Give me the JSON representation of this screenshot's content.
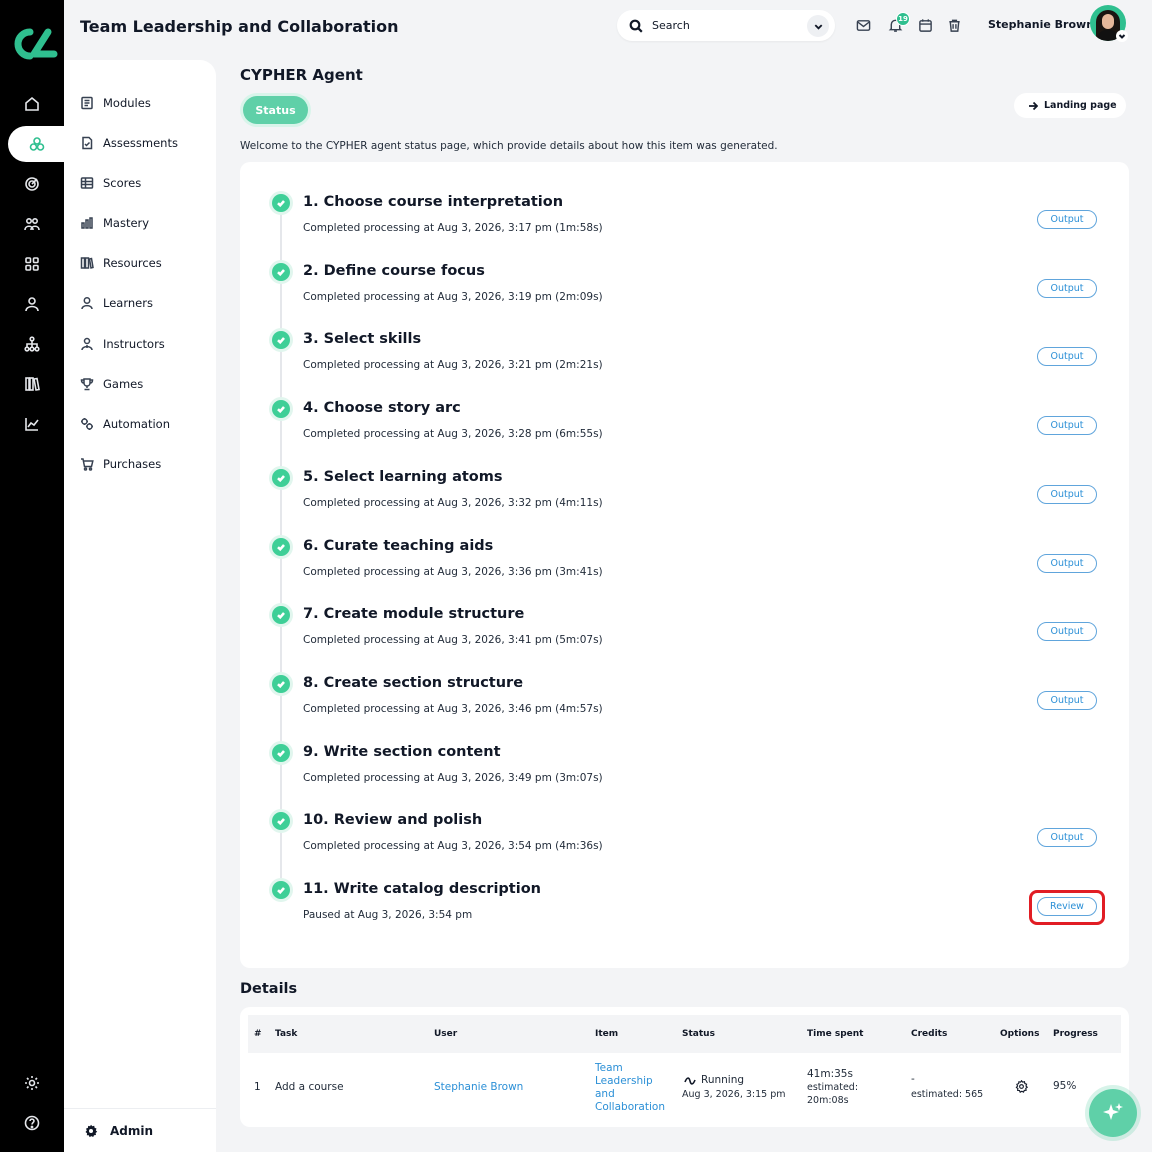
{
  "header": {
    "app_title": "Team Leadership and Collaboration",
    "search_placeholder": "Search",
    "notification_count": "19",
    "user_name": "Stephanie Brown"
  },
  "rail": {
    "icons": [
      "home-icon",
      "modules-icon",
      "target-icon",
      "people-icon",
      "apps-icon",
      "user-icon",
      "org-chart-icon",
      "library-icon",
      "analytics-icon"
    ],
    "bottom_icons": [
      "settings-icon",
      "help-icon"
    ]
  },
  "subnav": {
    "items": [
      {
        "label": "Modules",
        "icon": "modules-icon"
      },
      {
        "label": "Assessments",
        "icon": "assessments-icon"
      },
      {
        "label": "Scores",
        "icon": "scores-icon"
      },
      {
        "label": "Mastery",
        "icon": "mastery-icon"
      },
      {
        "label": "Resources",
        "icon": "resources-icon"
      },
      {
        "label": "Learners",
        "icon": "learners-icon"
      },
      {
        "label": "Instructors",
        "icon": "instructors-icon"
      },
      {
        "label": "Games",
        "icon": "games-icon"
      },
      {
        "label": "Automation",
        "icon": "automation-icon"
      },
      {
        "label": "Purchases",
        "icon": "purchases-icon"
      }
    ],
    "admin_label": "Admin"
  },
  "page": {
    "title": "CYPHER Agent",
    "status_tab": "Status",
    "landing_button": "Landing page",
    "welcome": "Welcome to the CYPHER agent status page, which provide details about how this item was generated."
  },
  "steps": [
    {
      "title": "1. Choose course interpretation",
      "subtitle": "Completed processing at Aug 3, 2026, 3:17 pm (1m:58s)",
      "button": "Output"
    },
    {
      "title": "2. Define course focus",
      "subtitle": "Completed processing at Aug 3, 2026, 3:19 pm (2m:09s)",
      "button": "Output"
    },
    {
      "title": "3. Select skills",
      "subtitle": "Completed processing at Aug 3, 2026, 3:21 pm (2m:21s)",
      "button": "Output"
    },
    {
      "title": "4. Choose story arc",
      "subtitle": "Completed processing at Aug 3, 2026, 3:28 pm (6m:55s)",
      "button": "Output"
    },
    {
      "title": "5. Select learning atoms",
      "subtitle": "Completed processing at Aug 3, 2026, 3:32 pm (4m:11s)",
      "button": "Output"
    },
    {
      "title": "6. Curate teaching aids",
      "subtitle": "Completed processing at Aug 3, 2026, 3:36 pm (3m:41s)",
      "button": "Output"
    },
    {
      "title": "7. Create module structure",
      "subtitle": "Completed processing at Aug 3, 2026, 3:41 pm (5m:07s)",
      "button": "Output"
    },
    {
      "title": "8. Create section structure",
      "subtitle": "Completed processing at Aug 3, 2026, 3:46 pm (4m:57s)",
      "button": "Output"
    },
    {
      "title": "9. Write section content",
      "subtitle": "Completed processing at Aug 3, 2026, 3:49 pm (3m:07s)",
      "button": ""
    },
    {
      "title": "10. Review and polish",
      "subtitle": "Completed processing at Aug 3, 2026, 3:54 pm (4m:36s)",
      "button": "Output"
    },
    {
      "title": "11. Write catalog description",
      "subtitle": "Paused at Aug 3, 2026, 3:54 pm",
      "button": "Review",
      "highlighted": true
    }
  ],
  "details": {
    "title": "Details",
    "columns": [
      "#",
      "Task",
      "User",
      "Item",
      "Status",
      "Time spent",
      "Credits",
      "Options",
      "Progress"
    ],
    "row": {
      "index": "1",
      "task": "Add a course",
      "user": "Stephanie Brown",
      "item_lines": [
        "Team",
        "Leadership",
        "and",
        "Collaboration"
      ],
      "status": "Running",
      "status_date": "Aug 3, 2026, 3:15 pm",
      "time_spent": "41m:35s",
      "time_estimated_label": "estimated:",
      "time_estimated": "20m:08s",
      "credits": "-",
      "credits_estimated": "estimated: 565",
      "progress": "95%"
    }
  },
  "colors": {
    "accent": "#2fbf8f",
    "link": "#2b8fd6",
    "highlight": "#e11d24"
  }
}
